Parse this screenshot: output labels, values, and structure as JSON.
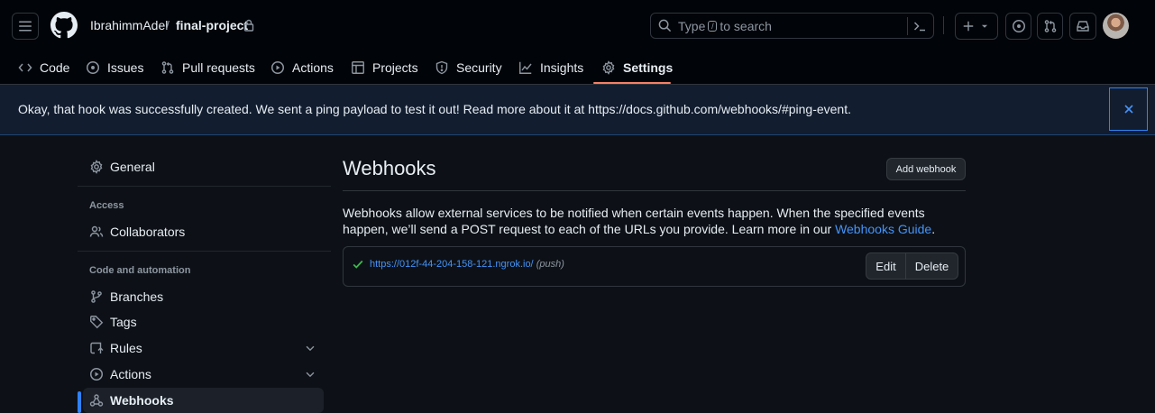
{
  "header": {
    "owner": "IbrahimmAdel",
    "separator": "/",
    "repo": "final-project",
    "search": {
      "prefix": "Type",
      "key": "/",
      "suffix": "to search"
    }
  },
  "tabs": [
    {
      "label": "Code",
      "icon": "code-icon"
    },
    {
      "label": "Issues",
      "icon": "issue-opened-icon"
    },
    {
      "label": "Pull requests",
      "icon": "git-pull-request-icon"
    },
    {
      "label": "Actions",
      "icon": "play-icon"
    },
    {
      "label": "Projects",
      "icon": "table-icon"
    },
    {
      "label": "Security",
      "icon": "shield-icon"
    },
    {
      "label": "Insights",
      "icon": "graph-icon"
    },
    {
      "label": "Settings",
      "icon": "gear-icon",
      "selected": true
    }
  ],
  "flash": {
    "message": "Okay, that hook was successfully created. We sent a ping payload to test it out! Read more about it at https://docs.github.com/webhooks/#ping-event."
  },
  "sidebar": {
    "general": "General",
    "access_heading": "Access",
    "collaborators": "Collaborators",
    "code_heading": "Code and automation",
    "branches": "Branches",
    "tags": "Tags",
    "rules": "Rules",
    "actions": "Actions",
    "webhooks": "Webhooks"
  },
  "main": {
    "title": "Webhooks",
    "add_button": "Add webhook",
    "description_before": "Webhooks allow external services to be notified when certain events happen. When the specified events happen, we’ll send a POST request to each of the URLs you provide. Learn more in our ",
    "description_link": "Webhooks Guide",
    "description_after": ".",
    "hook": {
      "url": "https://012f-44-204-158-121.ngrok.io/",
      "event": "(push)",
      "status": "success",
      "edit": "Edit",
      "delete": "Delete"
    }
  },
  "colors": {
    "background": "#0d1117",
    "header": "#010409",
    "accent": "#2f81f7",
    "tab_underline": "#f78166",
    "success": "#3fb950",
    "link": "#4493f8"
  }
}
